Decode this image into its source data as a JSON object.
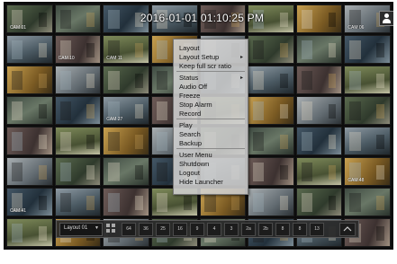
{
  "header": {
    "timestamp": "2016-01-01 01:10:25 PM",
    "user_icon": "user-icon"
  },
  "grid": {
    "cameras": [
      "CAM 01",
      "",
      "",
      "",
      "",
      "",
      "",
      "CAM 06",
      "",
      "CAM 10",
      "CAM 11",
      "",
      "",
      "",
      "",
      "",
      "",
      "",
      "",
      "",
      "",
      "",
      "",
      "",
      "",
      "",
      "CAM 27",
      "",
      "",
      "",
      "",
      "",
      "",
      "",
      "",
      "",
      "",
      "",
      "",
      "",
      "",
      "",
      "",
      "",
      "",
      "",
      "",
      "CAM 48",
      "CAM 41",
      "",
      "",
      "",
      "",
      "",
      "",
      "",
      "",
      "",
      "",
      "",
      "",
      "",
      "",
      ""
    ]
  },
  "context_menu": {
    "items": [
      {
        "label": "Layout",
        "submenu": false
      },
      {
        "label": "Layout Setup",
        "submenu": true
      },
      {
        "label": "Keep full scr ratio",
        "submenu": false
      },
      {
        "label": "Status",
        "submenu": true
      },
      {
        "label": "Audio Off",
        "submenu": false
      },
      {
        "label": "Freeze",
        "submenu": false
      },
      {
        "label": "Stop Alarm",
        "submenu": false
      },
      {
        "label": "Record",
        "submenu": false
      },
      {
        "label": "Play",
        "submenu": false
      },
      {
        "label": "Search",
        "submenu": false
      },
      {
        "label": "Backup",
        "submenu": false
      },
      {
        "label": "User Menu",
        "submenu": false
      },
      {
        "label": "Shutdown",
        "submenu": false
      },
      {
        "label": "Logout",
        "submenu": false
      },
      {
        "label": "Hide Launcher",
        "submenu": false
      }
    ]
  },
  "launcher": {
    "layout_value": "Layout 01",
    "buttons": [
      "64",
      "36",
      "25",
      "16",
      "9",
      "4",
      "3",
      "2a",
      "2b",
      "8",
      "8",
      "13"
    ],
    "icons": {
      "split": "split-screen-icon",
      "expand": "expand-icon",
      "dropdown": "chevron-down-icon"
    }
  },
  "bottom_bar": {
    "left": "",
    "right": ""
  }
}
